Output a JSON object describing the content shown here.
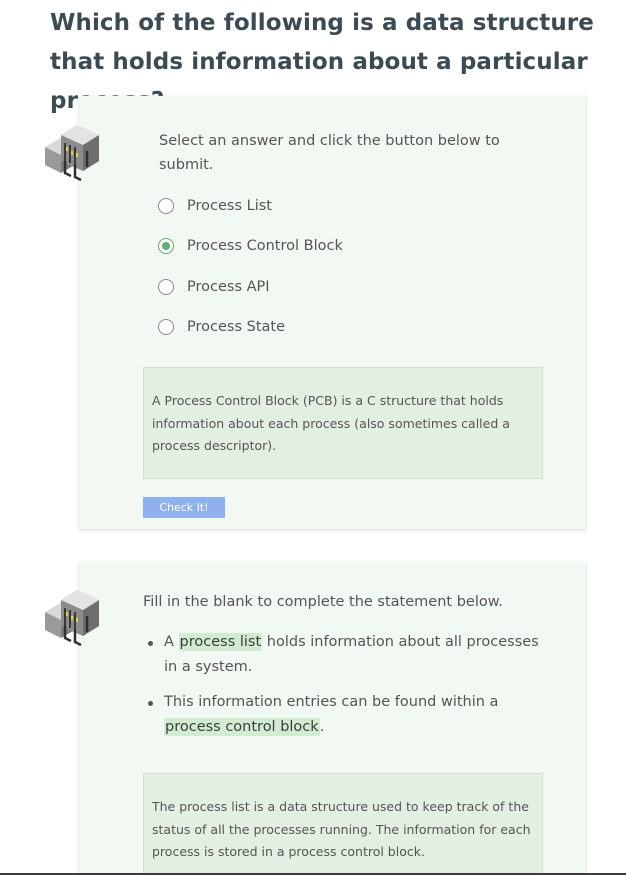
{
  "question": {
    "title": "Which of the following is a data structure that holds information about a particular process?",
    "instructions": "Select an answer and click the button below to submit.",
    "options": [
      {
        "label": "Process List",
        "selected": false
      },
      {
        "label": "Process Control Block",
        "selected": true
      },
      {
        "label": "Process API",
        "selected": false
      },
      {
        "label": "Process State",
        "selected": false
      }
    ],
    "feedback": "A Process Control Block (PCB) is a C structure that holds information about each process (also sometimes called a process descriptor).",
    "submit_label": "Check It!"
  },
  "fill_blank": {
    "instructions": "Fill in the blank to complete the statement below.",
    "statements": [
      {
        "before": "A ",
        "blank": "process list",
        "after": " holds information about all processes in a system."
      },
      {
        "before": "This information entries can be found within a ",
        "blank": "process control block",
        "after": "."
      }
    ],
    "feedback": "The process list is a data structure used to keep track of the status of all the processes running. The information for each process is stored in a process control block."
  },
  "colors": {
    "card_background": "#f2f8f2",
    "feedback_background": "#e2efe2",
    "selected_radio": "#5cae6a",
    "button": "#8fb2ee"
  },
  "icons": [
    "server-rack-icon",
    "server-rack-icon"
  ]
}
